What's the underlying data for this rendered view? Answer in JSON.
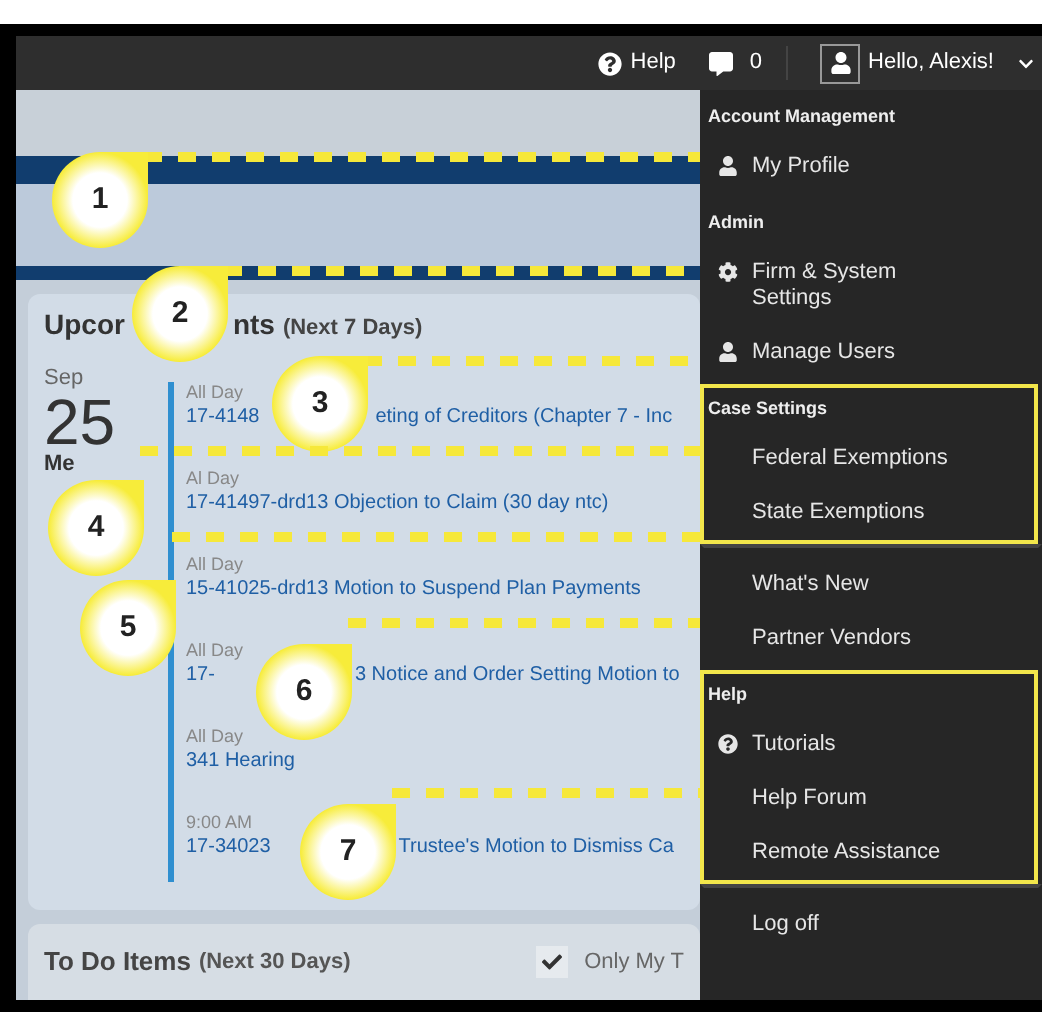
{
  "top_bar": {
    "help": "Help",
    "messages_count": "0",
    "greeting": "Hello, Alexis!"
  },
  "upcoming": {
    "title_parts": [
      "Upcor",
      "nts"
    ],
    "range": "(Next 7 Days)",
    "month": "Sep",
    "day": "25",
    "weekday": "Me",
    "events": [
      {
        "time": "All Day",
        "title_parts": [
          "17-4148",
          "eting of Creditors (Chapter 7 - Inc"
        ]
      },
      {
        "time": "Al Day",
        "title_parts": [
          "17-41497-drd13 Objection to Claim (30 day ntc)"
        ]
      },
      {
        "time": "All Day",
        "title_parts": [
          "15-41025-drd13 Motion to Suspend Plan Payments"
        ]
      },
      {
        "time": "All Day",
        "title_parts": [
          "17-",
          "3 Notice and Order Setting Motion to"
        ]
      },
      {
        "time": "All Day",
        "title_parts": [
          "341 Hearing"
        ]
      },
      {
        "time": "9:00 AM",
        "title_parts": [
          "17-34023",
          "Trustee's Motion to Dismiss Ca"
        ]
      }
    ]
  },
  "todo": {
    "title": "To Do Items",
    "range": "(Next 30 Days)",
    "filter": {
      "label": "Only My T",
      "checked": true
    }
  },
  "menu": {
    "sections": [
      {
        "header": "Account Management",
        "highlighted": false,
        "items": [
          {
            "label": "My Profile",
            "kind": "person"
          }
        ]
      },
      {
        "header": "Admin",
        "highlighted": false,
        "items": [
          {
            "label": "Firm & System Settings",
            "kind": "gear"
          },
          {
            "label": "Manage Users",
            "kind": "person"
          }
        ]
      },
      {
        "header": "Case Settings",
        "highlighted": true,
        "items": [
          {
            "label": "Federal Exemptions"
          },
          {
            "label": "State Exemptions"
          }
        ]
      },
      {
        "highlighted": false,
        "items": [
          {
            "label": "What's New"
          },
          {
            "label": "Partner Vendors"
          }
        ]
      },
      {
        "header": "Help",
        "highlighted": true,
        "items": [
          {
            "label": "Tutorials",
            "kind": "help"
          },
          {
            "label": "Help Forum"
          },
          {
            "label": "Remote Assistance"
          }
        ]
      },
      {
        "highlighted": false,
        "items": [
          {
            "label": "Log off"
          }
        ]
      }
    ]
  },
  "callouts": [
    {
      "number": "1"
    },
    {
      "number": "2"
    },
    {
      "number": "3"
    },
    {
      "number": "4"
    },
    {
      "number": "5"
    },
    {
      "number": "6"
    },
    {
      "number": "7"
    }
  ]
}
